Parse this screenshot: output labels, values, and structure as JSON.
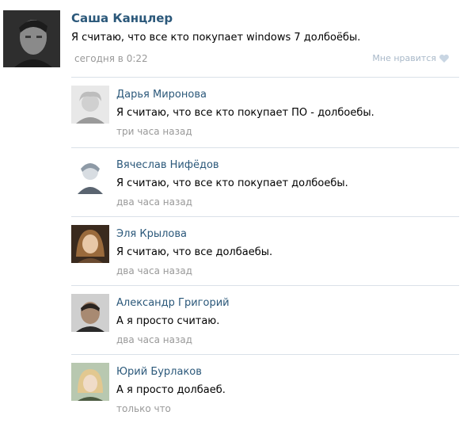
{
  "post": {
    "author": "Саша Канцлер",
    "text": "Я считаю, что все кто покупает windows 7 долбоёбы.",
    "time": "сегодня в 0:22",
    "like_label": "Мне нравится",
    "avatar_icon": "user-photo"
  },
  "comments": [
    {
      "author": "Дарья Миронова",
      "text": "Я считаю, что все кто покупает ПО - долбоебы.",
      "time": "три часа назад",
      "avatar_icon": "user-photo"
    },
    {
      "author": "Вячеслав Нифёдов",
      "text": "Я считаю, что все кто покупает долбоебы.",
      "time": "два часа назад",
      "avatar_icon": "user-photo"
    },
    {
      "author": "Эля Крылова",
      "text": "Я считаю, что все долбаебы.",
      "time": "два часа назад",
      "avatar_icon": "user-photo"
    },
    {
      "author": "Александр Григорий",
      "text": "А я просто считаю.",
      "time": "два часа назад",
      "avatar_icon": "user-photo"
    },
    {
      "author": "Юрий Бурлаков",
      "text": "А я просто долбаеб.",
      "time": "только что",
      "avatar_icon": "user-photo"
    }
  ],
  "colors": {
    "name_link": "#2b587a",
    "meta_text": "#999999",
    "divider": "#dae1e8"
  }
}
